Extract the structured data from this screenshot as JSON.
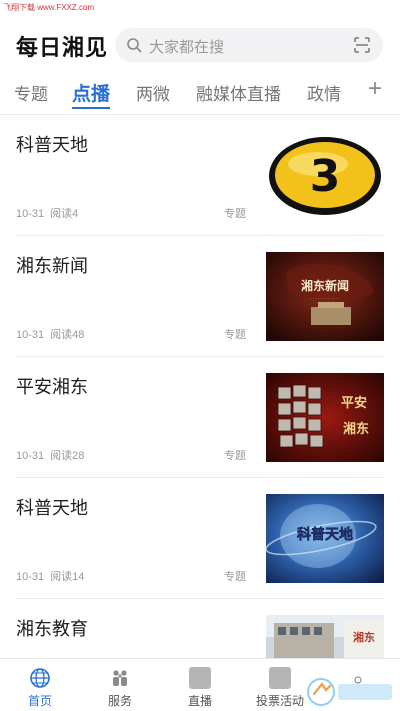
{
  "watermark": "飞翔下载 www.FXXZ.com",
  "header": {
    "title": "每日湘见",
    "search_placeholder": "大家都在搜"
  },
  "tabs": [
    {
      "label": "专题",
      "active": false
    },
    {
      "label": "点播",
      "active": true
    },
    {
      "label": "两微",
      "active": false
    },
    {
      "label": "融媒体直播",
      "active": false
    },
    {
      "label": "政情",
      "active": false
    }
  ],
  "feed": [
    {
      "title": "科普天地",
      "date": "10-31",
      "reads": "阅读4",
      "tag": "专题",
      "thumb": "number-3-icon"
    },
    {
      "title": "湘东新闻",
      "date": "10-31",
      "reads": "阅读48",
      "tag": "专题",
      "thumb": "news-program-cover",
      "thumb_text": "湘东新闻"
    },
    {
      "title": "平安湘东",
      "date": "10-31",
      "reads": "阅读28",
      "tag": "专题",
      "thumb": "safety-program-cover",
      "thumb_text": "平安湘东"
    },
    {
      "title": "科普天地",
      "date": "10-31",
      "reads": "阅读14",
      "tag": "专题",
      "thumb": "science-program-cover",
      "thumb_text": "科普天地"
    },
    {
      "title": "湘东教育",
      "date": "",
      "reads": "",
      "tag": "",
      "thumb": "education-program-cover",
      "thumb_text": "湘东"
    }
  ],
  "tabbar": [
    {
      "label": "首页",
      "icon": "globe-icon",
      "active": true
    },
    {
      "label": "服务",
      "icon": "people-icon",
      "active": false
    },
    {
      "label": "直播",
      "icon": "placeholder-icon",
      "active": false
    },
    {
      "label": "投票活动",
      "icon": "placeholder-icon",
      "active": false
    }
  ],
  "colors": {
    "accent": "#2a6fd6",
    "text": "#222222",
    "muted": "#999999"
  }
}
